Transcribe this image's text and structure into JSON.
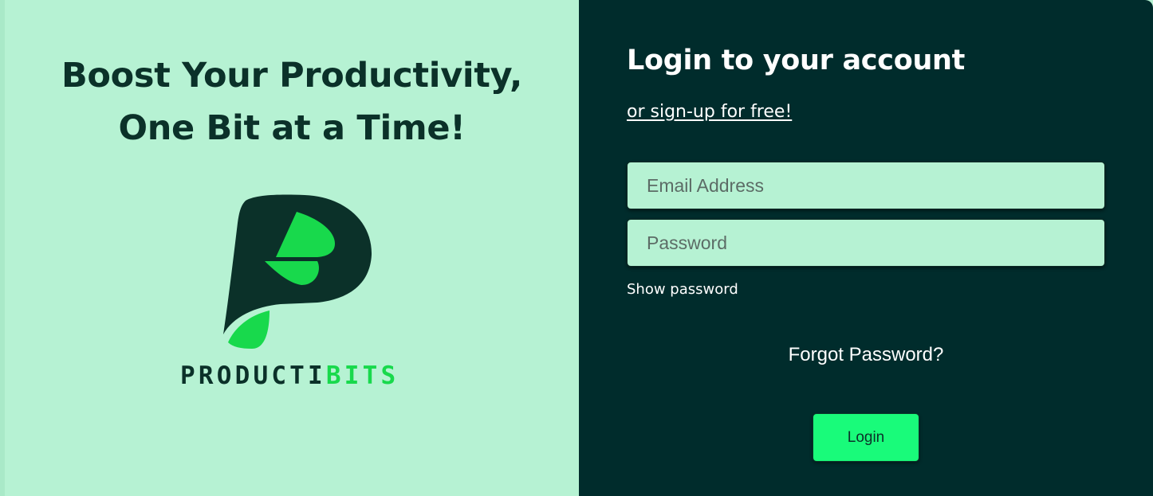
{
  "hero": {
    "headline_line1": "Boost Your Productivity,",
    "headline_line2": "One Bit at a Time!"
  },
  "brand": {
    "wordmark_dark": "PRODUCTI",
    "wordmark_green": "BITS",
    "logo_icon": "productibits-p-leaf-logo"
  },
  "login": {
    "title": "Login to your account",
    "signup_link": "or sign-up for free!",
    "email_placeholder": "Email Address",
    "password_placeholder": "Password",
    "show_password": "Show password",
    "forgot_password": "Forgot Password?",
    "login_button": "Login"
  },
  "colors": {
    "left_background": "#b6f2d3",
    "right_background": "#002c2c",
    "brand_dark": "#0b3129",
    "brand_green": "#18d94c",
    "button_green": "#19fb7a"
  }
}
